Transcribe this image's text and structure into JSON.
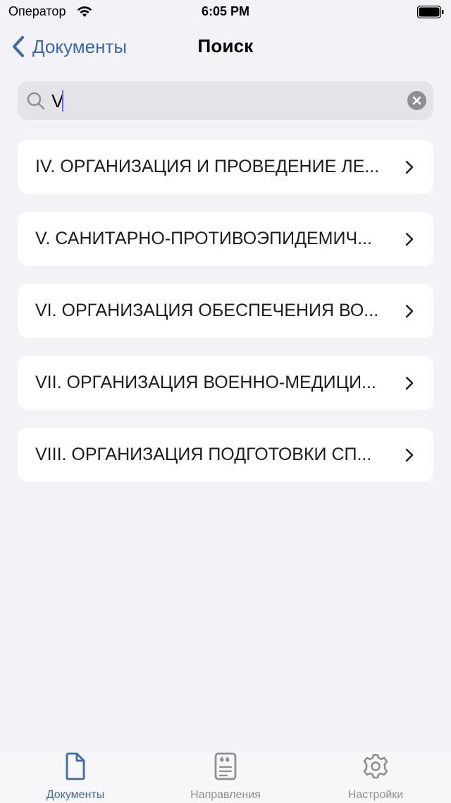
{
  "status_bar": {
    "carrier": "Оператор",
    "time": "6:05 PM"
  },
  "nav": {
    "back_label": "Документы",
    "title": "Поиск"
  },
  "search": {
    "value": "V",
    "placeholder": ""
  },
  "results": [
    {
      "label": "IV. ОРГАНИЗАЦИЯ И ПРОВЕДЕНИЕ ЛЕ..."
    },
    {
      "label": "V. САНИТАРНО-ПРОТИВОЭПИДЕМИЧ..."
    },
    {
      "label": "VI. ОРГАНИЗАЦИЯ ОБЕСПЕЧЕНИЯ ВО..."
    },
    {
      "label": "VII. ОРГАНИЗАЦИЯ ВОЕННО-МЕДИЦИ..."
    },
    {
      "label": "VIII. ОРГАНИЗАЦИЯ ПОДГОТОВКИ СП..."
    }
  ],
  "tabs": [
    {
      "label": "Документы",
      "icon": "document-icon",
      "active": true
    },
    {
      "label": "Направления",
      "icon": "quote-document-icon",
      "active": false
    },
    {
      "label": "Настройки",
      "icon": "gear-icon",
      "active": false
    }
  ],
  "colors": {
    "accent": "#3d6aa8",
    "background": "#f2f2f7",
    "search_field": "#e3e3e8",
    "inactive_tab": "#8e8e93"
  }
}
